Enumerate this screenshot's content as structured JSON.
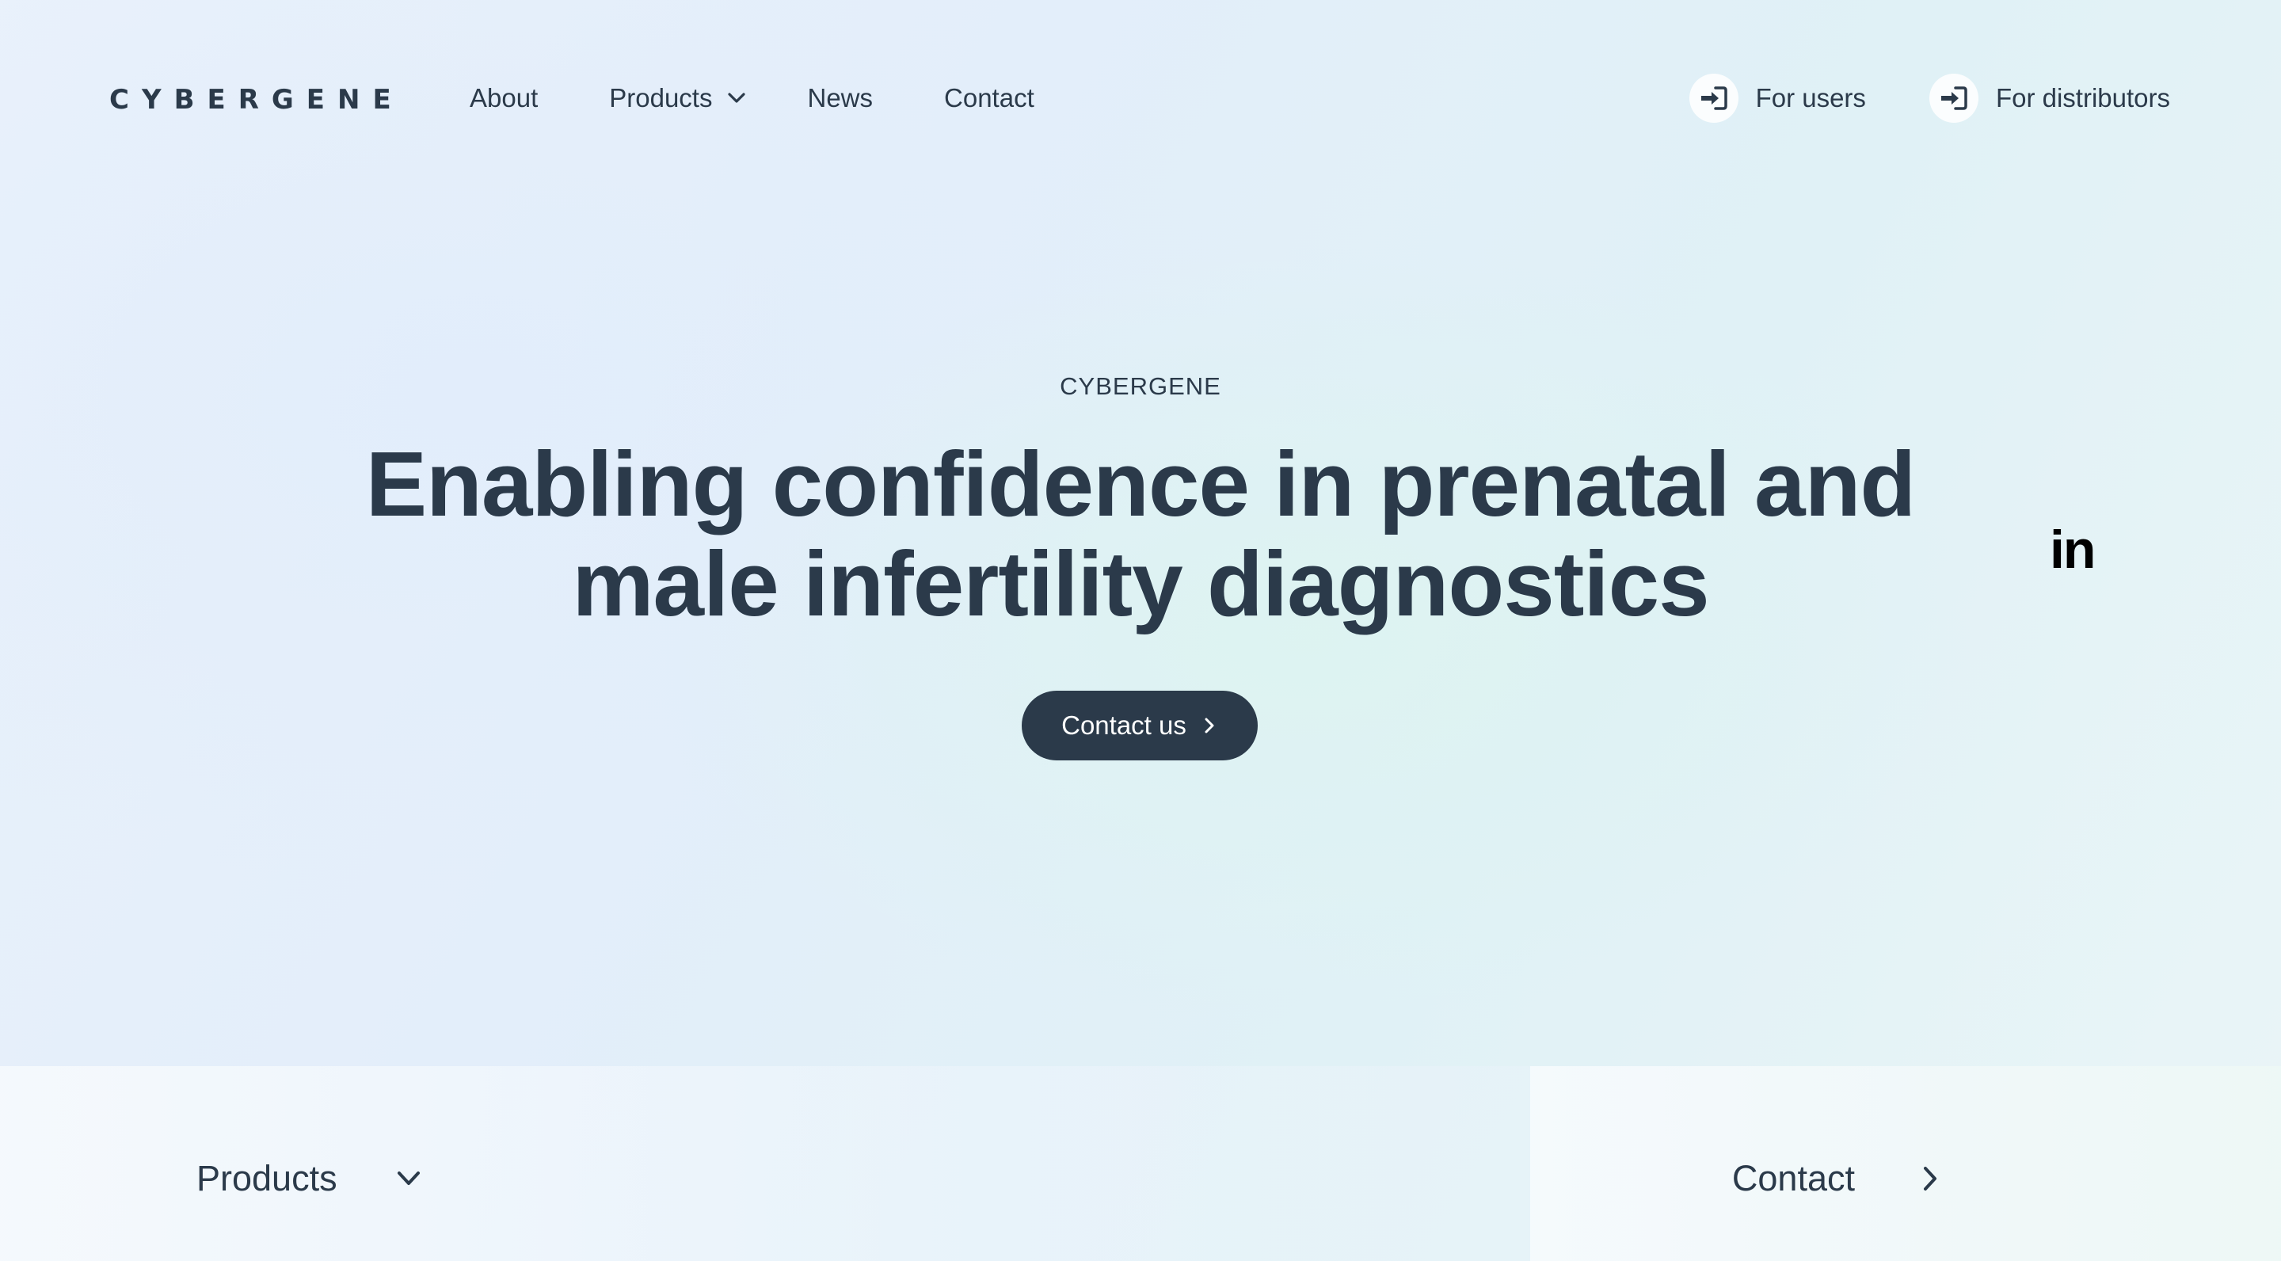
{
  "header": {
    "logo": "CYBERGENE",
    "nav": {
      "about": "About",
      "products": "Products",
      "news": "News",
      "contact": "Contact"
    },
    "right_links": {
      "users": "For users",
      "distributors": "For distributors"
    }
  },
  "hero": {
    "eyebrow": "CYBERGENE",
    "title": "Enabling confidence in prenatal and male infertility diagnostics",
    "cta_label": "Contact us"
  },
  "social": {
    "linkedin": "in"
  },
  "bottom_bar": {
    "products_label": "Products",
    "contact_label": "Contact"
  },
  "colors": {
    "primary_text": "#2b3a4a",
    "button_bg": "#2b3a4a",
    "button_text": "#ffffff"
  },
  "icons": {
    "nav_dropdown": "chevron-down-icon",
    "login": "sign-in-icon",
    "cta": "chevron-right-icon",
    "social": "linkedin-icon"
  }
}
